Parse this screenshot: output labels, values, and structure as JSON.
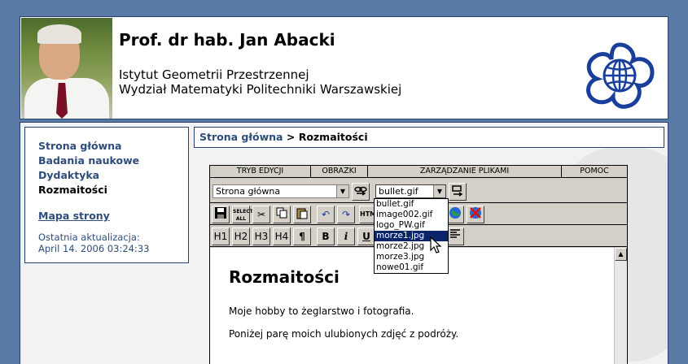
{
  "header": {
    "name": "Prof. dr hab. Jan Abacki",
    "institute": "Istytut Geometrii Przestrzennej",
    "faculty": "Wydział Matematyki Politechniki Warszawskiej"
  },
  "sidebar": {
    "items": [
      {
        "label": "Strona główna",
        "current": false
      },
      {
        "label": "Badania naukowe",
        "current": false
      },
      {
        "label": "Dydaktyka",
        "current": false
      },
      {
        "label": "Rozmaitości",
        "current": true
      }
    ],
    "sitemap": "Mapa strony",
    "update_label": "Ostatnia aktualizacja:",
    "update_date": "April 14. 2006 03:24:33"
  },
  "breadcrumb": {
    "home": "Strona główna",
    "separator": ">",
    "current": "Rozmaitości"
  },
  "editor": {
    "tabs": [
      "TRYB EDYCJI",
      "OBRAZKI",
      "ZARZĄDZANIE PLIKAMI",
      "POMOC"
    ],
    "page_select": "Strona główna",
    "image_select": "bullet.gif",
    "select_all": "SELECT ALL",
    "html_btn": "HTML",
    "headings": [
      "H1",
      "H2",
      "H3",
      "H4"
    ],
    "pilcrow": "¶",
    "bold": "B",
    "italic": "i",
    "underline": "U",
    "image_options": [
      {
        "label": "bullet.gif",
        "selected": false
      },
      {
        "label": "image002.gif",
        "selected": false
      },
      {
        "label": "logo_PW.gif",
        "selected": false
      },
      {
        "label": "morze1.jpg",
        "selected": true
      },
      {
        "label": "morze2.jpg",
        "selected": false
      },
      {
        "label": "morze3.jpg",
        "selected": false
      },
      {
        "label": "nowe01.gif",
        "selected": false
      }
    ],
    "content": {
      "title": "Rozmaitości",
      "p1": "Moje hobby to żeglarstwo i fotografia.",
      "p2": "Poniżej parę moich ulubionych zdjęć z podróży."
    }
  },
  "colors": {
    "background": "#5a7aa6",
    "border": "#28426f",
    "link": "#2e4d7b",
    "selection": "#0a246a",
    "logo": "#1a3f9a"
  },
  "icons": [
    "university-logo",
    "save-icon",
    "cut-icon",
    "copy-icon",
    "paste-icon",
    "undo-icon",
    "redo-icon",
    "link-icon",
    "globe-icon",
    "delete-icon",
    "align-icon",
    "mouse-cursor-icon"
  ]
}
